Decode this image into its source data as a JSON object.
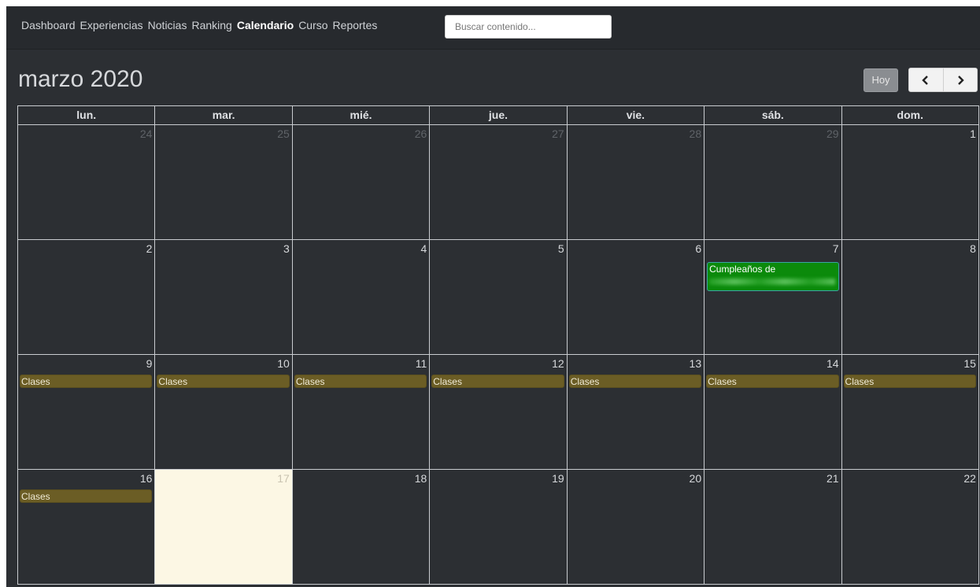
{
  "nav": {
    "links": [
      {
        "label": "Dashboard",
        "active": false
      },
      {
        "label": "Experiencias",
        "active": false
      },
      {
        "label": "Noticias",
        "active": false
      },
      {
        "label": "Ranking",
        "active": false
      },
      {
        "label": "Calendario",
        "active": true
      },
      {
        "label": "Curso",
        "active": false
      },
      {
        "label": "Reportes",
        "active": false
      }
    ],
    "search_placeholder": "Buscar contenido..."
  },
  "header": {
    "month_title": "marzo 2020",
    "today_label": "Hoy"
  },
  "calendar": {
    "weekdays": [
      "lun.",
      "mar.",
      "mié.",
      "jue.",
      "vie.",
      "sáb.",
      "dom."
    ],
    "weeks": [
      [
        {
          "day": "24",
          "other": true
        },
        {
          "day": "25",
          "other": true
        },
        {
          "day": "26",
          "other": true
        },
        {
          "day": "27",
          "other": true
        },
        {
          "day": "28",
          "other": true
        },
        {
          "day": "29",
          "other": true
        },
        {
          "day": "1"
        }
      ],
      [
        {
          "day": "2"
        },
        {
          "day": "3"
        },
        {
          "day": "4"
        },
        {
          "day": "5"
        },
        {
          "day": "6"
        },
        {
          "day": "7",
          "event": "Cumpleaños de",
          "event_type": "birthday"
        },
        {
          "day": "8"
        }
      ],
      [
        {
          "day": "9",
          "event": "Clases"
        },
        {
          "day": "10",
          "event": "Clases"
        },
        {
          "day": "11",
          "event": "Clases"
        },
        {
          "day": "12",
          "event": "Clases"
        },
        {
          "day": "13",
          "event": "Clases"
        },
        {
          "day": "14",
          "event": "Clases"
        },
        {
          "day": "15",
          "event": "Clases"
        }
      ],
      [
        {
          "day": "16",
          "event": "Clases"
        },
        {
          "day": "17",
          "today": true
        },
        {
          "day": "18"
        },
        {
          "day": "19"
        },
        {
          "day": "20"
        },
        {
          "day": "21"
        },
        {
          "day": "22"
        }
      ]
    ]
  },
  "colors": {
    "background": "#2c2f33",
    "today": "#fcf7e4",
    "class_event": "#6b5d25",
    "birthday_event": "#0b8a0b"
  }
}
